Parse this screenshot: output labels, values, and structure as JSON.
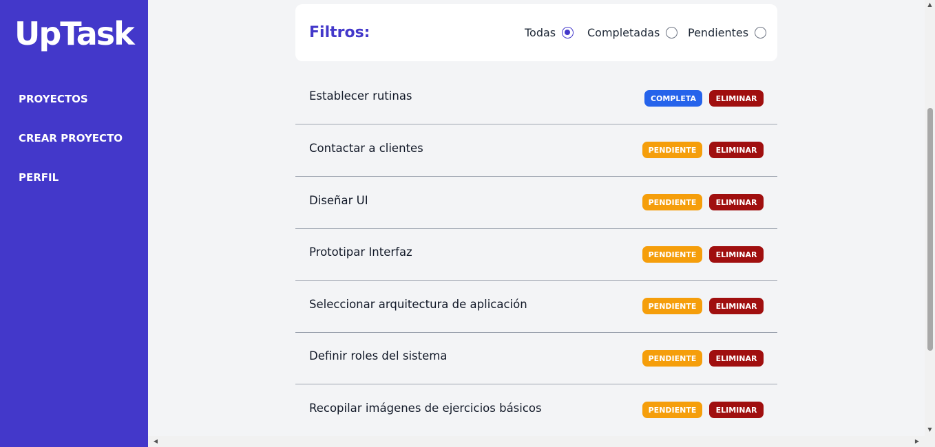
{
  "app": {
    "logo": "UpTask"
  },
  "sidebar": {
    "links": [
      {
        "label": "PROYECTOS"
      },
      {
        "label": "CREAR PROYECTO"
      },
      {
        "label": "PERFIL"
      }
    ]
  },
  "filters": {
    "title": "Filtros:",
    "options": [
      {
        "label": "Todas",
        "checked": true
      },
      {
        "label": "Completadas",
        "checked": false
      },
      {
        "label": "Pendientes",
        "checked": false
      }
    ]
  },
  "tasks": [
    {
      "name": "Establecer rutinas",
      "status": "COMPLETA",
      "delete": "ELIMINAR"
    },
    {
      "name": "Contactar a clientes",
      "status": "PENDIENTE",
      "delete": "ELIMINAR"
    },
    {
      "name": "Diseñar UI",
      "status": "PENDIENTE",
      "delete": "ELIMINAR"
    },
    {
      "name": "Prototipar Interfaz",
      "status": "PENDIENTE",
      "delete": "ELIMINAR"
    },
    {
      "name": "Seleccionar arquitectura de aplicación",
      "status": "PENDIENTE",
      "delete": "ELIMINAR"
    },
    {
      "name": "Definir roles del sistema",
      "status": "PENDIENTE",
      "delete": "ELIMINAR"
    },
    {
      "name": "Recopilar imágenes de ejercicios básicos",
      "status": "PENDIENTE",
      "delete": "ELIMINAR"
    }
  ],
  "colors": {
    "brand": "#4338ca",
    "complete": "#2563eb",
    "pending": "#f59e0b",
    "delete": "#a00f0f",
    "background": "#f3f4f6"
  }
}
